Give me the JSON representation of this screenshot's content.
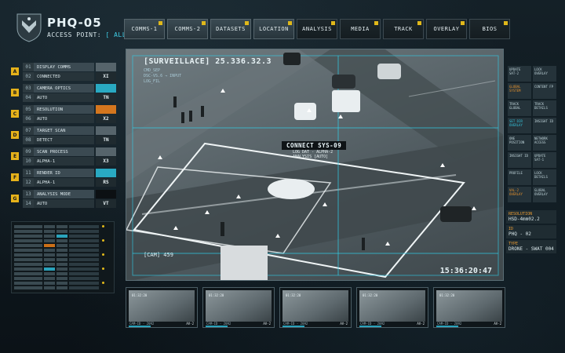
{
  "header": {
    "title": "PHQ-05",
    "access_label": "ACCESS POINT:",
    "access_value": "[ ALL DATASETS ]"
  },
  "nav": [
    {
      "label": "COMMS-1",
      "dark": false
    },
    {
      "label": "COMMS-2",
      "dark": false
    },
    {
      "label": "DATASETS",
      "dark": false
    },
    {
      "label": "LOCATION",
      "dark": false
    },
    {
      "label": "ANALYSIS",
      "dark": true
    },
    {
      "label": "MEDIA",
      "dark": true
    },
    {
      "label": "TRACK",
      "dark": true
    },
    {
      "label": "OVERLAY",
      "dark": true
    },
    {
      "label": "BIOS",
      "dark": true
    }
  ],
  "left_groups": [
    {
      "badge": "A",
      "rows": [
        {
          "num": "01",
          "label": "DISPLAY COMMS",
          "value": "",
          "style": "blank"
        },
        {
          "num": "02",
          "label": "CONNECTED",
          "value": "XI",
          "style": "default"
        }
      ]
    },
    {
      "badge": "B",
      "rows": [
        {
          "num": "03",
          "label": "CAMERA OPTICS",
          "value": "",
          "style": "cyan"
        },
        {
          "num": "04",
          "label": "AUTO",
          "value": "TN",
          "style": "default"
        }
      ]
    },
    {
      "badge": "C",
      "rows": [
        {
          "num": "05",
          "label": "RESOLUTION",
          "value": "",
          "style": "orange"
        },
        {
          "num": "06",
          "label": "AUTO",
          "value": "X2",
          "style": "default"
        }
      ]
    },
    {
      "badge": "D",
      "rows": [
        {
          "num": "07",
          "label": "TARGET SCAN",
          "value": "",
          "style": "blank"
        },
        {
          "num": "08",
          "label": "DETECT",
          "value": "TN",
          "style": "default"
        }
      ]
    },
    {
      "badge": "E",
      "rows": [
        {
          "num": "09",
          "label": "SCAN PROCESS",
          "value": "",
          "style": "blank"
        },
        {
          "num": "10",
          "label": "ALPHA-1",
          "value": "X3",
          "style": "default"
        }
      ]
    },
    {
      "badge": "F",
      "rows": [
        {
          "num": "11",
          "label": "RENDER ID",
          "value": "",
          "style": "cyan"
        },
        {
          "num": "12",
          "label": "ALPHA-1",
          "value": "RS",
          "style": "default"
        }
      ]
    },
    {
      "badge": "G",
      "rows": [
        {
          "num": "13",
          "label": "ANALYSIS MODE",
          "value": "",
          "style": "dark"
        },
        {
          "num": "14",
          "label": "AUTO",
          "value": "VT",
          "style": "default"
        }
      ]
    }
  ],
  "main": {
    "title": "[SURVEILLACE] 25.336.32.3",
    "sub_lines": [
      "CMD_SEP",
      "DSC-VS.6  → INPUT",
      "LOG_FIL"
    ],
    "target_title": "CONNECT SYS-09",
    "target_line1": "LOG DAT - ALPHA-2",
    "target_line2": "ANALYSIS [AUTO]",
    "cam_label": "[CAM] 459",
    "timestamp": "15:36:20:47"
  },
  "right_cells": [
    {
      "text": "UPDATE SAT-2",
      "style": "default"
    },
    {
      "text": "LOCK OVERLAY",
      "style": "default"
    },
    {
      "text": "GLOBAL SYSTEM",
      "style": "orange"
    },
    {
      "text": "CONTENT FP",
      "style": "default"
    },
    {
      "text": "TRACK GLOBAL",
      "style": "default"
    },
    {
      "text": "TRACK DETAILS",
      "style": "default"
    },
    {
      "text": "SET DIR OVERLAY",
      "style": "cyan"
    },
    {
      "text": "INSIGHT ID",
      "style": "default"
    },
    {
      "text": "ONE POSITION",
      "style": "default"
    },
    {
      "text": "NETWORK ACCESS",
      "style": "default"
    },
    {
      "text": "INSIGHT ID",
      "style": "default"
    },
    {
      "text": "UPDATE SAT-1",
      "style": "default"
    },
    {
      "text": "PROFILE",
      "style": "default"
    },
    {
      "text": "LOCK DETAILS",
      "style": "default"
    },
    {
      "text": "VAL-2 OVERLAY",
      "style": "orange"
    },
    {
      "text": "GLOBAL OVERLAY",
      "style": "default"
    }
  ],
  "right_info": [
    {
      "label": "RESOLUTION",
      "value": "HSD-4mm02.2"
    },
    {
      "label": "ID",
      "value": "PHQ - 02"
    },
    {
      "label": "TYPE",
      "value": "DRONE - SWAT 004"
    }
  ],
  "thumbs": [
    {
      "time": "01:32:20",
      "cam": "CAM-ID - 2092",
      "sel": "AV-2"
    },
    {
      "time": "01:32:20",
      "cam": "CAM-ID - 2092",
      "sel": "AV-2"
    },
    {
      "time": "01:32:20",
      "cam": "CAM-ID - 2092",
      "sel": "AV-2"
    },
    {
      "time": "01:32:20",
      "cam": "CAM-ID - 2092",
      "sel": "AV-2"
    },
    {
      "time": "01:32:20",
      "cam": "CAM-ID - 2092",
      "sel": "AV-2"
    }
  ]
}
